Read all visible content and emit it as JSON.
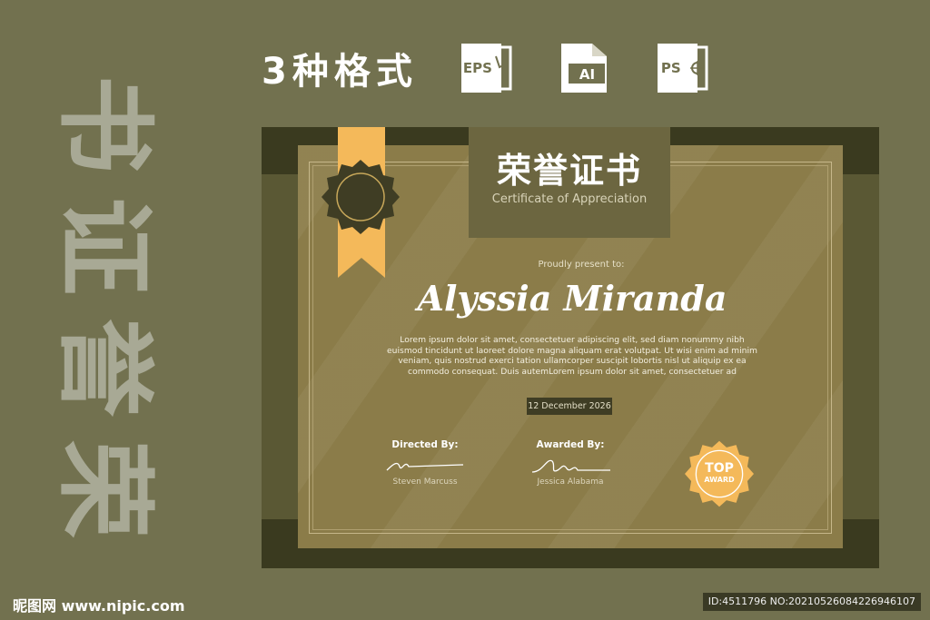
{
  "vertical_title": [
    "书",
    "证",
    "誉",
    "荣"
  ],
  "formats": {
    "label": "3种格式",
    "icons": [
      {
        "name": "eps-file-icon",
        "text": "EPS"
      },
      {
        "name": "ai-file-icon",
        "text": "AI"
      },
      {
        "name": "ps-file-icon",
        "text": "PS"
      }
    ]
  },
  "certificate": {
    "title_zh": "荣誉证书",
    "title_en": "Certificate of Appreciation",
    "proudly": "Proudly present to:",
    "recipient": "Alyssia Miranda",
    "body": "Lorem ipsum dolor sit amet, consectetuer adipiscing elit, sed diam nonummy nibh euismod tincidunt ut laoreet dolore magna aliquam erat volutpat. Ut wisi enim ad minim veniam, quis nostrud exerci tation ullamcorper suscipit lobortis nisl ut aliquip ex ea commodo consequat. Duis autemLorem ipsum dolor sit amet, consectetuer ad",
    "date": "12 December 2026",
    "signers": [
      {
        "role": "Directed By:",
        "name": "Steven Marcuss"
      },
      {
        "role": "Awarded By:",
        "name": "Jessica Alabama"
      }
    ],
    "award": {
      "line1": "TOP",
      "line2": "AWARD"
    }
  },
  "colors": {
    "background": "#72714f",
    "paper": "#8b7c49",
    "ribbon": "#f4b95a",
    "seal": "#3f3d24"
  },
  "footer": {
    "left": "昵图网 www.nipic.com",
    "right": "ID:4511796 NO:20210526084226946107"
  }
}
